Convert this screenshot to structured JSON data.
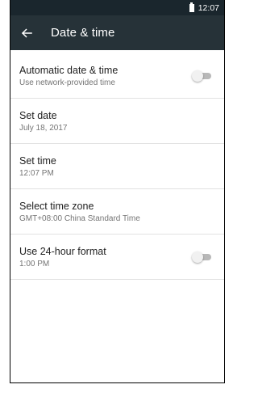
{
  "status_bar": {
    "time": "12:07",
    "battery_icon": "battery-icon"
  },
  "app_bar": {
    "back_icon": "arrow-back-icon",
    "title": "Date & time"
  },
  "settings": [
    {
      "title": "Automatic date & time",
      "summary": "Use network-provided time",
      "switch": {
        "on": false
      }
    },
    {
      "title": "Set date",
      "summary": "July 18, 2017"
    },
    {
      "title": "Set time",
      "summary": "12:07 PM"
    },
    {
      "title": "Select time zone",
      "summary": "GMT+08:00 China Standard Time"
    },
    {
      "title": "Use 24-hour format",
      "summary": "1:00 PM",
      "switch": {
        "on": false
      }
    }
  ],
  "colors": {
    "status_bar": "#1a262d",
    "app_bar": "#263238",
    "divider": "#e2e2e2",
    "switch_track_off": "#b8b8b8",
    "switch_thumb_off": "#f1f1f1"
  }
}
